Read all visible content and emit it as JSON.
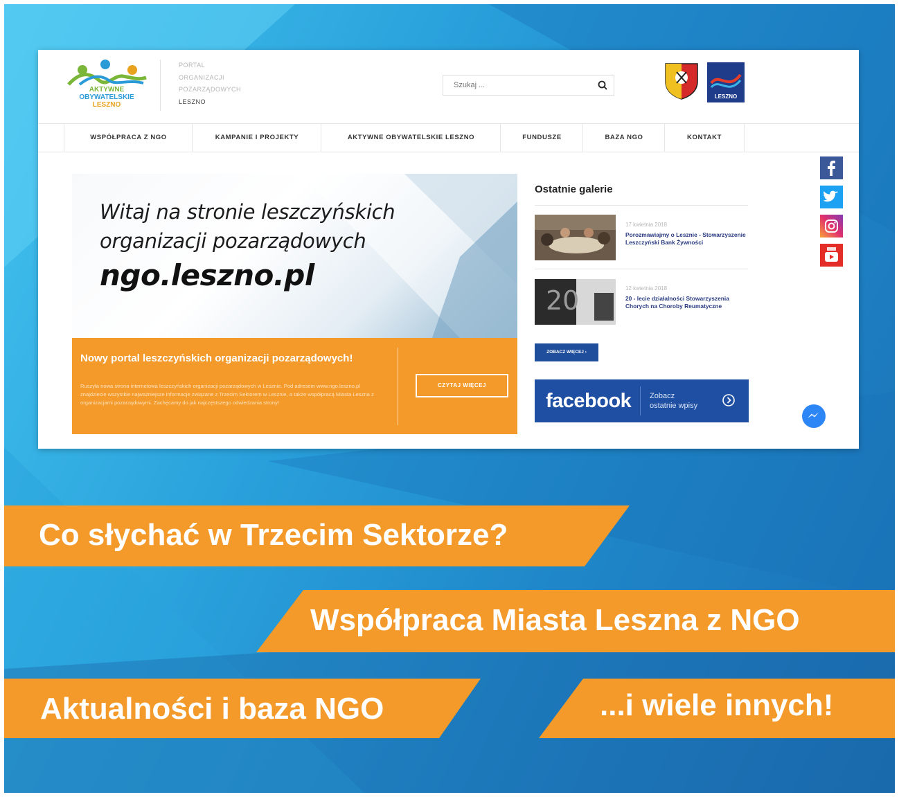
{
  "colors": {
    "orange": "#f39a2a",
    "navy": "#1e4fa2",
    "brand_blue": "#2b9bd8"
  },
  "logo": {
    "line1": "AKTYWNE",
    "line2": "OBYWATELSKIE",
    "line3": "LESZNO"
  },
  "portal": {
    "line1": "PORTAL",
    "line2": "ORGANIZACJI",
    "line3": "POZARZĄDOWYCH",
    "city": "LESZNO"
  },
  "search": {
    "placeholder": "Szukaj ..."
  },
  "nav": [
    "WSPÓŁPRACA Z NGO",
    "KAMPANIE I PROJEKTY",
    "AKTYWNE OBYWATELSKIE LESZNO",
    "FUNDUSZE",
    "BAZA NGO",
    "KONTAKT"
  ],
  "hero": {
    "line1": "Witaj na stronie leszczyńskich",
    "line2": "organizacji pozarządowych",
    "domain": "ngo.leszno.pl"
  },
  "promo": {
    "title": "Nowy portal leszczyńskich organizacji pozarządowych!",
    "body": "Ruszyła nowa strona internetowa leszczyńskich organizacji pozarządowych w Lesznie. Pod adresem www.ngo.leszno.pl znajdziecie wszystkie najważniejsze informacje związane z Trzecim Sektorem w Lesznie, a także współpracą Miasta Leszna z organizacjami pozarządowymi. Zachęcamy do jak najczęstszego odwiedzania strony!",
    "button": "CZYTAJ WIĘCEJ"
  },
  "galleries": {
    "title": "Ostatnie galerie",
    "items": [
      {
        "date": "17 kwietnia 2018",
        "caption": "Porozmawiajmy o Lesznie - Stowarzyszenie Leszczyński Bank Żywności"
      },
      {
        "date": "12 kwietnia 2018",
        "caption": "20 - lecie działalności Stowarzyszenia Chorych na Choroby Reumatyczne"
      }
    ],
    "thumb_number": "20",
    "see_more": "ZOBACZ WIĘCEJ"
  },
  "facebook": {
    "word": "facebook",
    "sub1": "Zobacz",
    "sub2": "ostatnie wpisy"
  },
  "social": [
    "facebook-icon",
    "twitter-icon",
    "instagram-icon",
    "youtube-icon"
  ],
  "crest_label": "LESZNO",
  "banners": [
    "Co słychać w Trzecim Sektorze?",
    "Współpraca Miasta Leszna z NGO",
    "Aktualności i baza NGO",
    "...i wiele innych!"
  ]
}
